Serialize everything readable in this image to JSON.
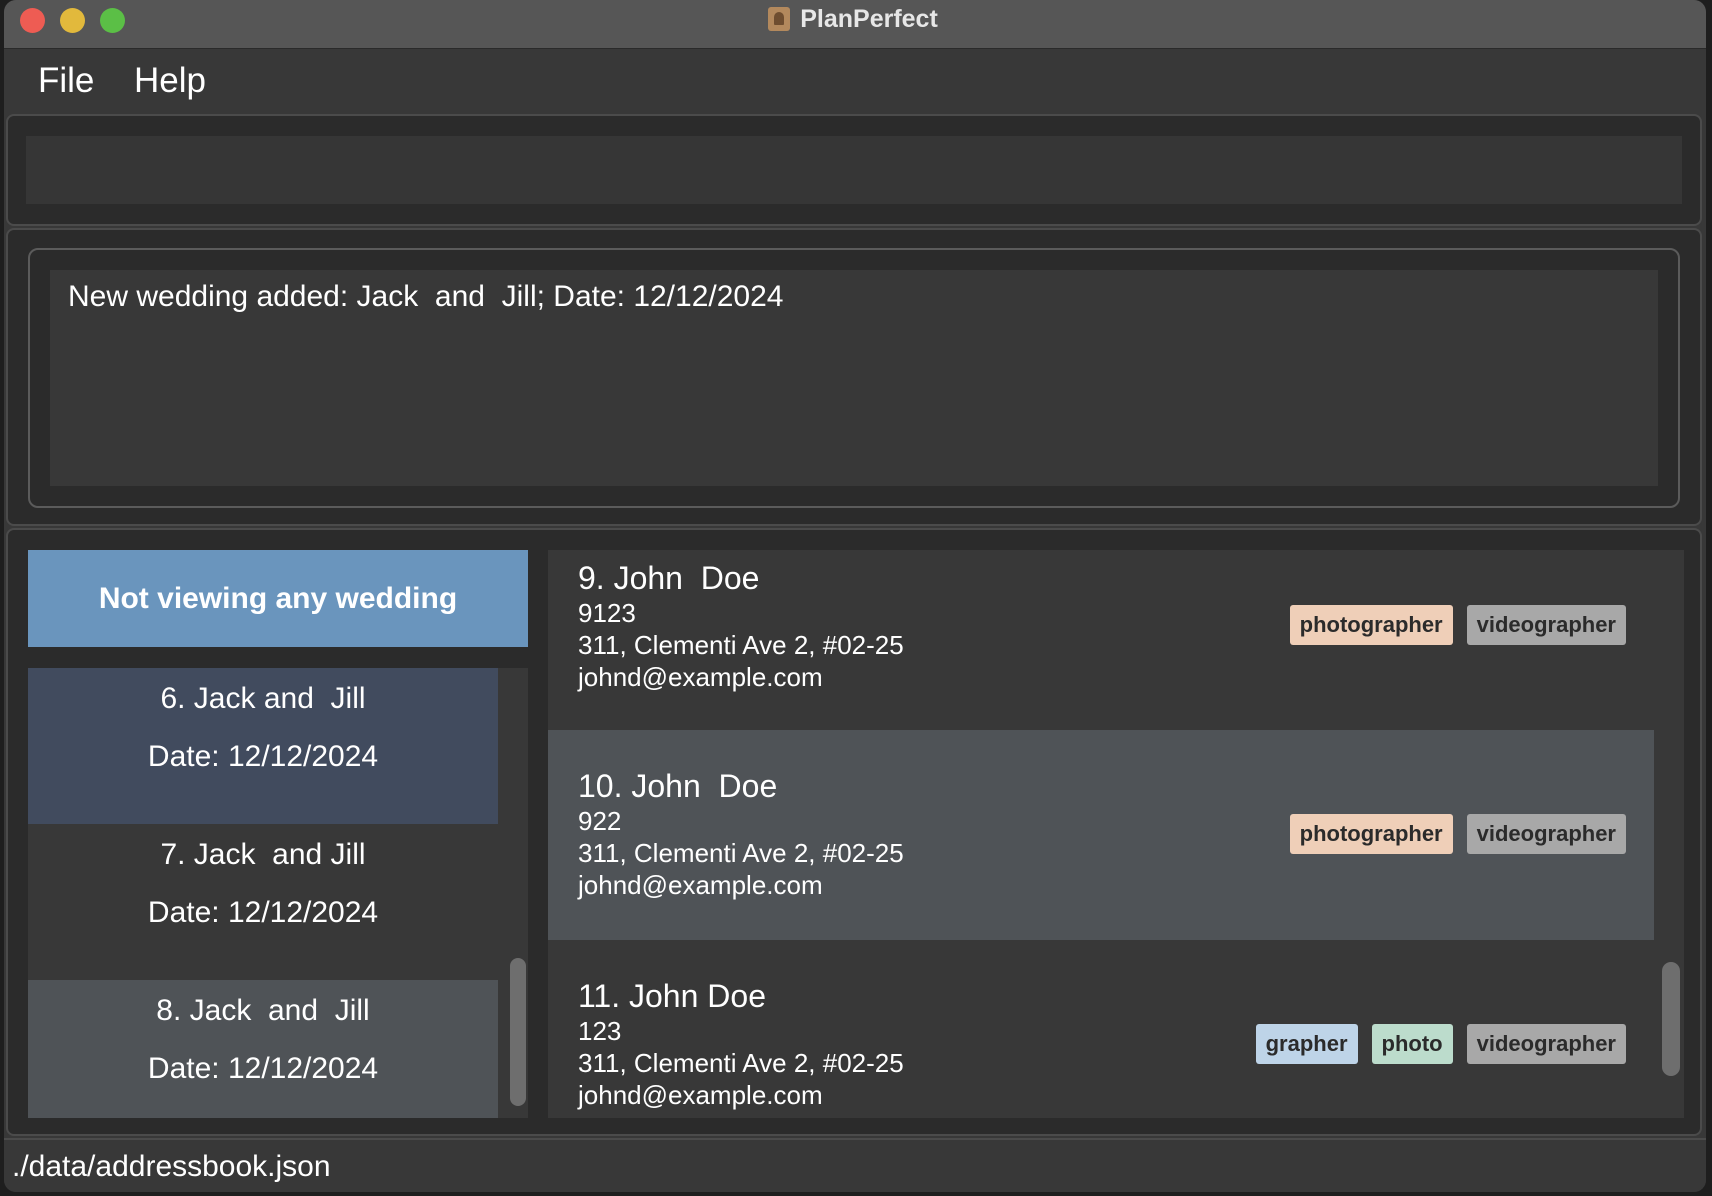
{
  "window": {
    "title": "PlanPerfect"
  },
  "menu": {
    "file": "File",
    "help": "Help"
  },
  "command": {
    "value": "",
    "placeholder": ""
  },
  "result": {
    "message": "New wedding added: Jack  and  Jill; Date: 12/12/2024"
  },
  "weddings": {
    "header": "Not viewing any wedding",
    "items": [
      {
        "name": "6. Jack and  Jill",
        "date": "Date: 12/12/2024",
        "bg": "#414b5e"
      },
      {
        "name": "7. Jack  and Jill",
        "date": "Date: 12/12/2024",
        "bg": "#383838"
      },
      {
        "name": "8. Jack  and  Jill",
        "date": "Date: 12/12/2024",
        "bg": "#4f5357"
      }
    ]
  },
  "persons": [
    {
      "name": "9. John  Doe",
      "phone": "9123",
      "address": "311, Clementi Ave 2, #02-25",
      "email": "johnd@example.com",
      "bg": "#383838",
      "tags": [
        {
          "label": "photographer",
          "color": "#efcfb8"
        },
        {
          "label": "videographer",
          "color": "#a8a8a8"
        }
      ]
    },
    {
      "name": "10. John  Doe",
      "phone": "922",
      "address": "311, Clementi Ave 2, #02-25",
      "email": "johnd@example.com",
      "bg": "#4f5357",
      "tags": [
        {
          "label": "photographer",
          "color": "#efcfb8"
        },
        {
          "label": "videographer",
          "color": "#a8a8a8"
        }
      ]
    },
    {
      "name": "11. John Doe",
      "phone": "123",
      "address": "311, Clementi Ave 2, #02-25",
      "email": "johnd@example.com",
      "bg": "#383838",
      "tags": [
        {
          "label": "grapher",
          "color": "#bed4e8"
        },
        {
          "label": "photo",
          "color": "#bcdccc"
        },
        {
          "label": "videographer",
          "color": "#a8a8a8"
        }
      ]
    }
  ],
  "status": {
    "path": "./data/addressbook.json"
  },
  "colors": {
    "accent": "#6a95bd",
    "selected": "#414b5e"
  }
}
